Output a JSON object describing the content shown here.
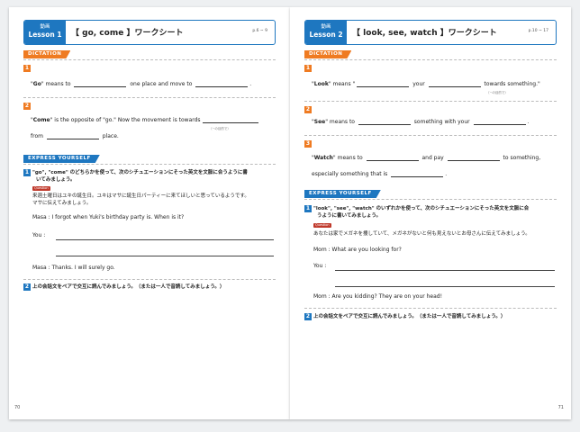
{
  "left": {
    "header": {
      "badge_top": "動画",
      "badge_bottom": "Lesson 1",
      "title": "【 go, come 】ワークシート",
      "page_ref": "p.6 ~ 9"
    },
    "dictation_label": "DICTATION",
    "q1": {
      "num": "1",
      "pre": "Go",
      "t1": " means to ",
      "t2": " one place and move to ",
      "t3": "."
    },
    "q2": {
      "num": "2",
      "pre": "Come",
      "t1": " is the opposite of \"go.\" Now the movement is towards",
      "note": "（~の目的で）",
      "t2": "from ",
      "t3": " place."
    },
    "express_label": "EXPRESS YOURSELF",
    "e1": {
      "num": "1",
      "line1": "\"go\", \"come\" のどちらかを使って、次のシチュエーションにそった英文を文脈に合うように書",
      "line2": "いてみましょう。",
      "tag": "Question",
      "jp1": "来週土曜日はユキの誕生日。ユキはマサに誕生日パーティーに来てほしいと思っているようです。",
      "jp2": "マサに伝えてみましょう。",
      "masa1": "Masa : I forgot when Yuki's birthday party is.  When is it?",
      "you": "You   :",
      "masa2": "Masa : Thanks.  I will surely go."
    },
    "e2": {
      "num": "2",
      "text": "上の会話文をペアで交互に読んでみましょう。（または一人で音読してみましょう。）"
    },
    "folio": "70"
  },
  "right": {
    "header": {
      "badge_top": "動画",
      "badge_bottom": "Lesson 2",
      "title": "【 look, see, watch 】ワークシート",
      "page_ref": "p.10 ~ 17"
    },
    "dictation_label": "DICTATION",
    "q1": {
      "num": "1",
      "pre": "Look",
      "t1": " means \"",
      "t2": " your ",
      "t3": " towards something.\"",
      "note": "（~の目的で）"
    },
    "q2": {
      "num": "2",
      "pre": "See",
      "t1": " means to ",
      "t2": " something with your ",
      "t3": "."
    },
    "q3": {
      "num": "3",
      "pre": "Watch",
      "t1": " means to ",
      "t2": " and pay ",
      "t3": " to something,",
      "line2a": "especially something that is ",
      "line2b": "."
    },
    "express_label": "EXPRESS YOURSELF",
    "e1": {
      "num": "1",
      "line1": "\"look\", \"see\", \"watch\" のいずれかを使って、次のシチュエーションにそった英文を文脈に合",
      "line2": "うように書いてみましょう。",
      "tag": "Question",
      "jp1": "あなたは家でメガネを捜していて、メガネがないと何も見えないとお母さんに伝えてみましょう。",
      "mom1": "Mom : What are you looking for?",
      "you": "You   :",
      "mom2": "Mom : Are you kidding?  They are on your head!"
    },
    "e2": {
      "num": "2",
      "text": "上の会話文をペアで交互に読んでみましょう。（または一人で音読してみましょう。）"
    },
    "folio": "71"
  }
}
